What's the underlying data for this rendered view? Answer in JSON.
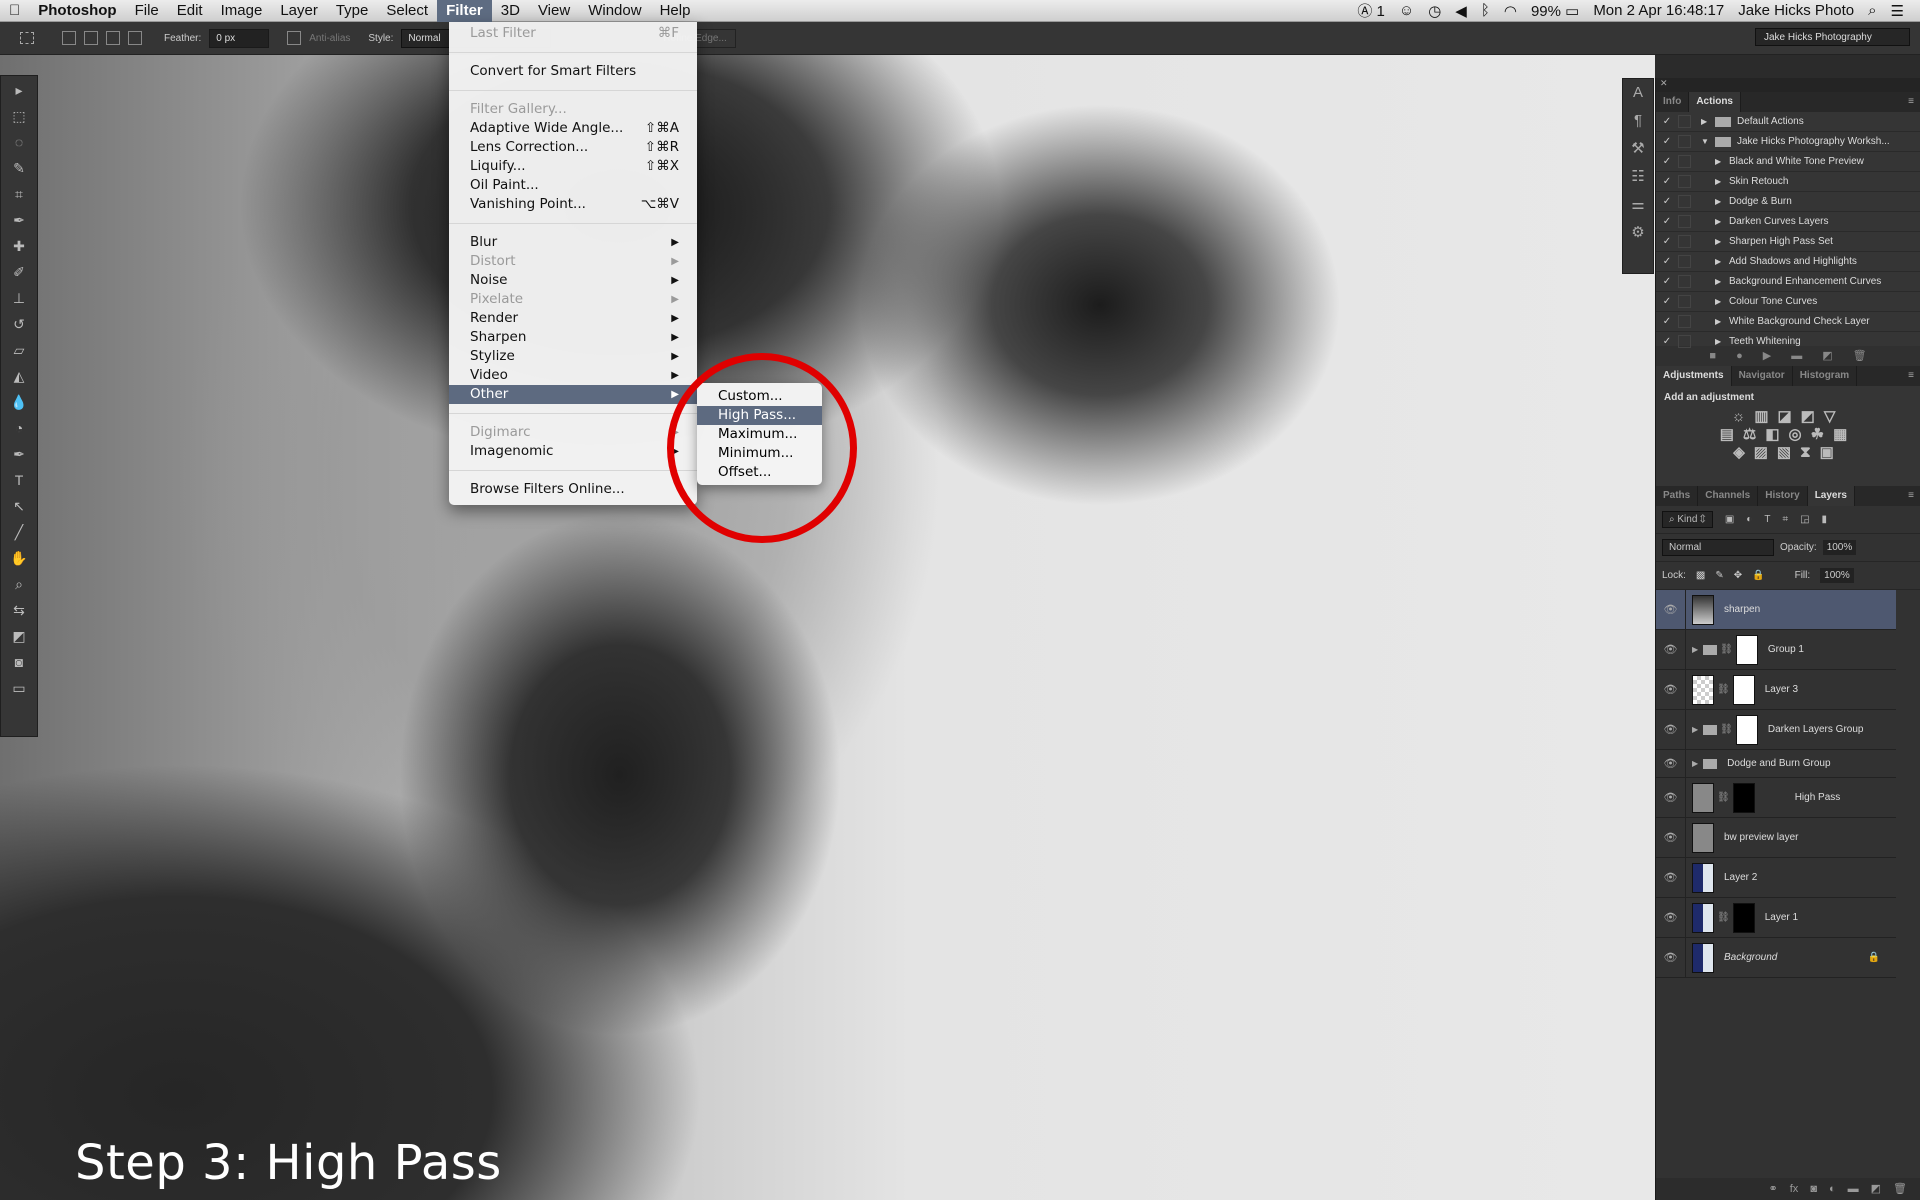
{
  "menubar": {
    "apple_icon": "apple-icon",
    "app": "Photoshop",
    "items": [
      "File",
      "Edit",
      "Image",
      "Layer",
      "Type",
      "Select",
      "Filter",
      "3D",
      "View",
      "Window",
      "Help"
    ],
    "active": "Filter",
    "status": {
      "adobe": "1",
      "battery": "99%",
      "datetime": "Mon 2 Apr  16:48:17",
      "user": "Jake Hicks Photo"
    }
  },
  "options": {
    "feather_label": "Feather:",
    "feather_value": "0 px",
    "antialias_label": "Anti-alias",
    "style_label": "Style:",
    "style_value": "Normal",
    "refine_edge": "Refine Edge...",
    "workspace": "Jake Hicks Photography"
  },
  "filter_menu": {
    "items": [
      {
        "label": "Last Filter",
        "shortcut": "⌘F",
        "disabled": true
      },
      {
        "sep": true
      },
      {
        "label": "Convert for Smart Filters"
      },
      {
        "sep": true
      },
      {
        "label": "Filter Gallery...",
        "disabled": true
      },
      {
        "label": "Adaptive Wide Angle...",
        "shortcut": "⇧⌘A"
      },
      {
        "label": "Lens Correction...",
        "shortcut": "⇧⌘R"
      },
      {
        "label": "Liquify...",
        "shortcut": "⇧⌘X"
      },
      {
        "label": "Oil Paint..."
      },
      {
        "label": "Vanishing Point...",
        "shortcut": "⌥⌘V"
      },
      {
        "sep": true
      },
      {
        "label": "Blur",
        "submenu": true
      },
      {
        "label": "Distort",
        "submenu": true,
        "disabled": true
      },
      {
        "label": "Noise",
        "submenu": true
      },
      {
        "label": "Pixelate",
        "submenu": true,
        "disabled": true
      },
      {
        "label": "Render",
        "submenu": true
      },
      {
        "label": "Sharpen",
        "submenu": true
      },
      {
        "label": "Stylize",
        "submenu": true
      },
      {
        "label": "Video",
        "submenu": true
      },
      {
        "label": "Other",
        "submenu": true,
        "highlighted": true
      },
      {
        "sep": true
      },
      {
        "label": "Digimarc",
        "submenu": true,
        "disabled": true
      },
      {
        "label": "Imagenomic",
        "submenu": true
      },
      {
        "sep": true
      },
      {
        "label": "Browse Filters Online..."
      }
    ]
  },
  "other_submenu": {
    "items": [
      {
        "label": "Custom..."
      },
      {
        "label": "High Pass...",
        "highlighted": true
      },
      {
        "label": "Maximum..."
      },
      {
        "label": "Minimum..."
      },
      {
        "label": "Offset..."
      }
    ]
  },
  "annotation": {
    "caption": "Step 3: High Pass",
    "circle_color": "#e00000"
  },
  "actions_panel": {
    "tabs": [
      "Info",
      "Actions"
    ],
    "active_tab": "Actions",
    "items": [
      {
        "label": "Default Actions",
        "type": "set",
        "expanded": false
      },
      {
        "label": "Jake Hicks Photography Worksh...",
        "type": "set",
        "expanded": true
      },
      {
        "label": "Black and White Tone Preview"
      },
      {
        "label": "Skin Retouch"
      },
      {
        "label": "Dodge & Burn"
      },
      {
        "label": "Darken Curves Layers"
      },
      {
        "label": "Sharpen High Pass Set"
      },
      {
        "label": "Add Shadows and Highlights"
      },
      {
        "label": "Background Enhancement Curves"
      },
      {
        "label": "Colour Tone Curves"
      },
      {
        "label": "White Background Check Layer"
      },
      {
        "label": "Teeth Whitening"
      }
    ]
  },
  "adjustments_panel": {
    "tabs": [
      "Adjustments",
      "Navigator",
      "Histogram"
    ],
    "active_tab": "Adjustments",
    "heading": "Add an adjustment"
  },
  "layers_panel": {
    "tabs": [
      "Paths",
      "Channels",
      "History",
      "Layers"
    ],
    "active_tab": "Layers",
    "kind": "Kind",
    "blend_mode": "Normal",
    "opacity_label": "Opacity:",
    "opacity": "100%",
    "lock_label": "Lock:",
    "fill_label": "Fill:",
    "fill": "100%",
    "layers": [
      {
        "name": "sharpen",
        "selected": true
      },
      {
        "name": "Group 1",
        "group": true,
        "mask": true
      },
      {
        "name": "Layer 3",
        "mask": true
      },
      {
        "name": "Darken Layers Group",
        "group": true,
        "mask": true
      },
      {
        "name": "Dodge and Burn Group",
        "group": true
      },
      {
        "name": "High Pass",
        "mask": true
      },
      {
        "name": "bw preview layer"
      },
      {
        "name": "Layer 2"
      },
      {
        "name": "Layer 1",
        "mask": true
      },
      {
        "name": "Background",
        "locked": true
      }
    ]
  }
}
